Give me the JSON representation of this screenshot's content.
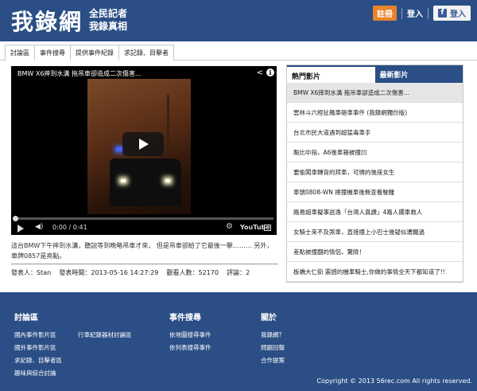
{
  "header": {
    "logo": "我錄網",
    "slogan_line1": "全民記者",
    "slogan_line2": "我錄真相",
    "register_label": "註冊",
    "login_label": "登入",
    "fb_login_label": "登入",
    "fb_icon_letter": "f"
  },
  "nav": {
    "tabs": [
      "討論區",
      "事件搜尋",
      "提供事件紀錄",
      "求記錄、目擊者"
    ]
  },
  "video": {
    "title": "BMW X6摔到水溝 拖吊車卻造成二次傷害...",
    "current_time": "0:00",
    "duration": "0:41",
    "time_display": "0:00 / 0:41",
    "brand": "YouTube",
    "progress": 0
  },
  "post": {
    "description": "這台BMW下午摔到水溝，聽說等到晚略吊車才來， 但是吊車卻給了它最後一擊……… 另外，車牌0857是亮點。",
    "author_label": "發表人：",
    "author": "Stan",
    "time_label": "發表時間：",
    "time": "2013-05-16 14:27:29",
    "views_label": "觀看人數：",
    "views": "52170",
    "comments_label": "評論：",
    "comments": "2"
  },
  "sidebar": {
    "tab_hot": "熱門影片",
    "tab_new": "最新影片",
    "items": [
      "BMW X6摔到水溝 拖吊車卻造成二次傷害...",
      "雲林斗六經扯飆車砸車事件 (我錄網獨份版)",
      "台北市民大道遇到超猛毒車手",
      "颱比中指，A6後車箱被撞凹",
      "要偷闖車轉背的拜車，可憐的後座女生",
      "車號0808-WN 擦撞機車後無查看駛離",
      "路易超車擬事逃逸「台灣人真讚」4路人攔車救人",
      "女騎士來不及煞車，直接撞上小巴士後疑似遭輾過",
      "差點被撞翻的情侶，驚險！",
      "板橋大仁街 震撼的機車騎士,你做的事情全天下都知道了!!"
    ]
  },
  "footer": {
    "col1_title": "討論區",
    "col1_links": [
      "國內事件影片區",
      "國外事件影片區",
      "求記錄、目擊者區",
      "趣味與綜合討論"
    ],
    "col1b_links": [
      "行車紀錄器材討論區"
    ],
    "col2_title": "事件搜尋",
    "col2_links": [
      "依地圖搜尋事件",
      "依列表搜尋事件"
    ],
    "col3_title": "關於",
    "col3_links": [
      "我錄網？",
      "問題回報",
      "合作提案"
    ],
    "copyright": "Copyright © 2013 56rec.com All rights reserved."
  }
}
